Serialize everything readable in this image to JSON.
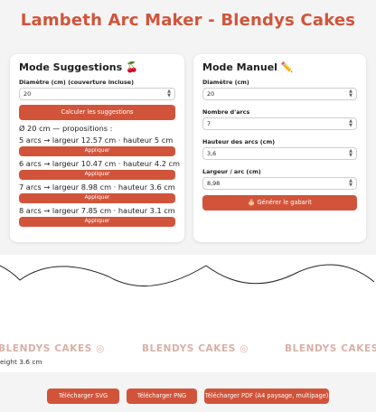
{
  "page": {
    "title": "Lambeth Arc Maker - Blendys Cakes"
  },
  "suggestions": {
    "title": "Mode Suggestions",
    "title_emoji": "🍒",
    "diameter_label": "Diamètre (cm) (couverture incluse)",
    "diameter_value": "20",
    "calc_button": "Calculer les suggestions",
    "summary": "Ø 20 cm — propositions :",
    "items": [
      {
        "text": "5 arcs → largeur 12.57 cm · hauteur 5 cm",
        "button": "Appliquer"
      },
      {
        "text": "6 arcs → largeur 10.47 cm · hauteur 4.2 cm",
        "button": "Appliquer"
      },
      {
        "text": "7 arcs → largeur 8.98 cm · hauteur 3.6 cm",
        "button": "Appliquer"
      },
      {
        "text": "8 arcs → largeur 7.85 cm · hauteur 3.1 cm",
        "button": "Appliquer"
      }
    ]
  },
  "manual": {
    "title": "Mode Manuel",
    "title_emoji": "✏️",
    "diameter_label": "Diamètre (cm)",
    "diameter_value": "20",
    "arcs_label": "Nombre d'arcs",
    "arcs_value": "7",
    "height_label": "Hauteur des arcs (cm)",
    "height_value": "3,6",
    "width_label": "Largeur / arc (cm)",
    "width_value": "8,98",
    "generate_button": "🎂 Générer le gabarit"
  },
  "preview": {
    "watermark_left": "BLENDYS CAKES ◎",
    "watermark_center": "BLENDYS CAKES ◎",
    "watermark_right": "BLENDYS CAKES ◎",
    "height_note": "eight 3.6 cm"
  },
  "downloads": {
    "svg": "Télécharger SVG",
    "png": "Télécharger PNG",
    "pdf": "Télécharger PDF (A4 paysage, multipage)"
  },
  "colors": {
    "accent": "#d1543a",
    "watermark": "#d9b0a6"
  }
}
